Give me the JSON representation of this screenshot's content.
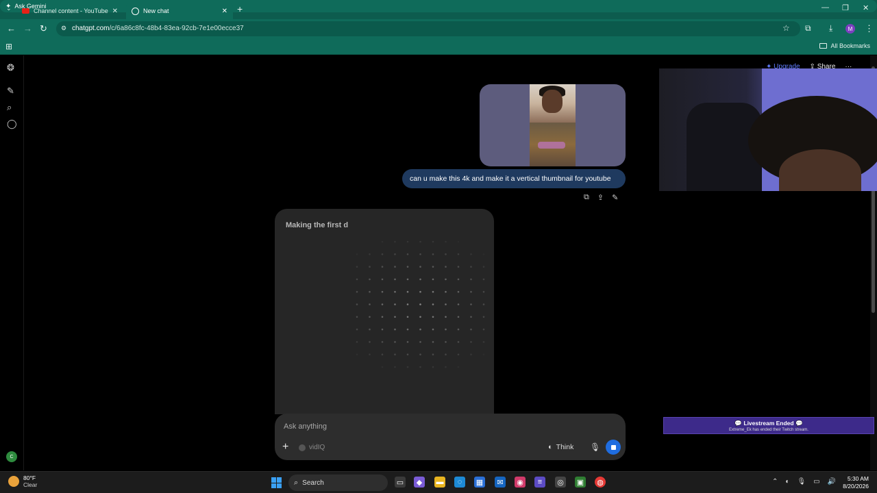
{
  "browser": {
    "tabs": [
      {
        "title": "Channel content - YouTube Stu",
        "close": "✕"
      },
      {
        "title": "New chat",
        "close": "✕"
      }
    ],
    "new_tab": "+",
    "ask_gemini": "Ask Gemini",
    "window_controls": {
      "minimize": "—",
      "restore": "❐",
      "close": "✕"
    },
    "url_host": "chatgpt.com",
    "url_path": "/c/6a86c8fc-48b4-83ea-92cb-7e1e00ecce37",
    "profile_initial": "M",
    "all_bookmarks": "All Bookmarks"
  },
  "header": {
    "upgrade": "Upgrade",
    "share": "Share",
    "more": "···"
  },
  "chat": {
    "user_message": "can u make this 4k and make it a vertical thumbnail for youtube",
    "generating_label": "Making the first d",
    "composer": {
      "placeholder": "Ask anything",
      "tool_label": "vidIQ",
      "think_label": "Think"
    }
  },
  "sidebar": {
    "user_initial": "C"
  },
  "overlay": {
    "livestream_title": "Livestream Ended",
    "livestream_sub": "Extreme_Ek has ended their Twitch stream."
  },
  "taskbar": {
    "weather_temp": "80°F",
    "weather_desc": "Clear",
    "search_label": "Search",
    "time": "5:30 AM",
    "date": "8/20/2026"
  },
  "colors": {
    "chrome_bg": "#0f6b5a",
    "user_bubble": "#1f3a5f",
    "stop_button": "#1f6de0",
    "upgrade": "#5f7cff",
    "livestream_banner": "#3d2a8a"
  }
}
